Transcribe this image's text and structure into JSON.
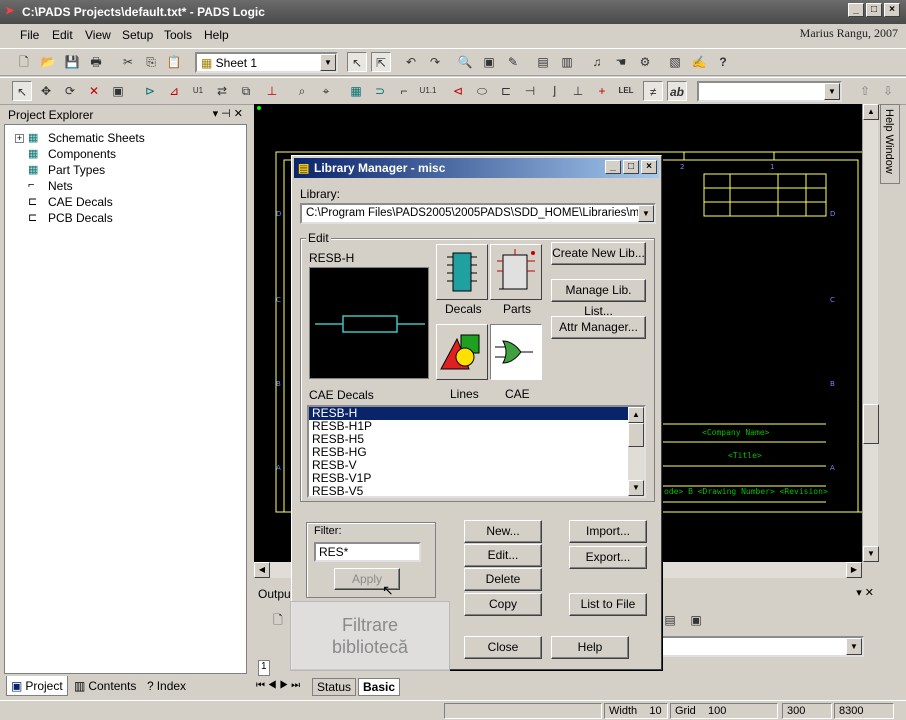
{
  "window": {
    "title": "C:\\PADS Projects\\default.txt* - PADS Logic"
  },
  "author": "Marius Rangu, 2007",
  "menu": [
    "File",
    "Edit",
    "View",
    "Setup",
    "Tools",
    "Help"
  ],
  "toolbar": {
    "sheet_value": "Sheet 1"
  },
  "explorer": {
    "title": "Project Explorer",
    "items": [
      "Schematic Sheets",
      "Components",
      "Part Types",
      "Nets",
      "CAE Decals",
      "PCB Decals"
    ],
    "tabs": [
      "Project",
      "Contents",
      "Index"
    ]
  },
  "output": {
    "title": "Output"
  },
  "bottom_tabs": [
    "Status",
    "Basic"
  ],
  "help_window": "Help Window",
  "dialog": {
    "title": "Library Manager - misc",
    "library_label": "Library:",
    "library_value": "C:\\Program Files\\PADS2005\\2005PADS\\SDD_HOME\\Libraries\\misc",
    "edit_group": "Edit",
    "preview_name": "RESB-H",
    "decals_label": "Decals",
    "parts_label": "Parts",
    "lines_label": "Lines",
    "cae_label": "CAE",
    "create_new_lib": "Create New Lib...",
    "manage_lib_list": "Manage Lib. List...",
    "attr_manager": "Attr Manager...",
    "list_label": "CAE Decals",
    "list_items": [
      "RESB-H",
      "RESB-H1P",
      "RESB-H5",
      "RESB-HG",
      "RESB-V",
      "RESB-V1P",
      "RESB-V5"
    ],
    "filter_label": "Filter:",
    "filter_value": "RES*",
    "apply": "Apply",
    "new": "New...",
    "edit": "Edit...",
    "delete": "Delete",
    "copy": "Copy",
    "import": "Import...",
    "export": "Export...",
    "list_to_file": "List to File",
    "close": "Close",
    "help": "Help"
  },
  "tooltip_lines": [
    "Filtrare",
    "bibliotecă"
  ],
  "schematic": {
    "company": "<Company Name>",
    "title": "<Title>",
    "drawing_row": "ode> B <Drawing Number> <Revision>"
  },
  "status": {
    "width_label": "Width",
    "width_value": "10",
    "grid_label": "Grid",
    "grid_value": "100",
    "x": "300",
    "y": "8300"
  },
  "colors": {
    "titlebar": "#0a246a",
    "schematic_lines": "#ffff66",
    "schematic_text": "#00c000"
  }
}
